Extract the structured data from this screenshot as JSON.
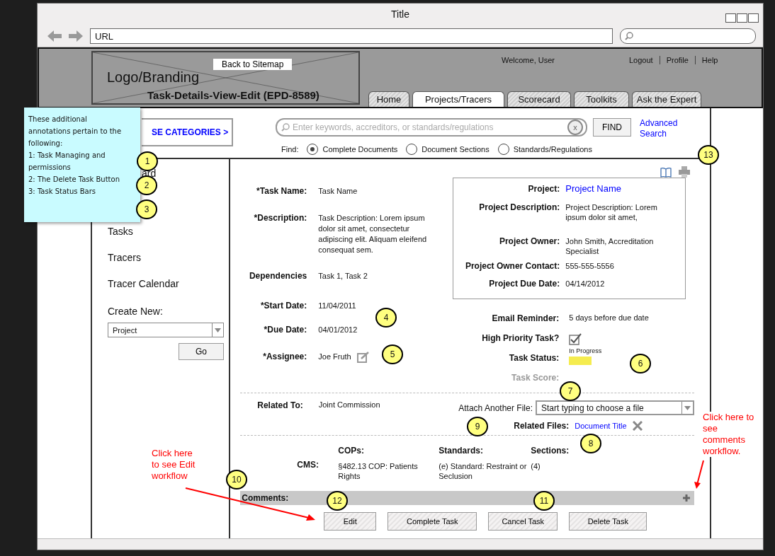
{
  "window": {
    "title": "Title",
    "url": "URL"
  },
  "header": {
    "back_button": "Back to Sitemap",
    "logo": "Logo/Branding",
    "page_title": "Task-Details-View-Edit (EPD-8589)",
    "welcome": "Welcome, User",
    "links": [
      "Logout",
      "Profile",
      "Help"
    ],
    "tabs": [
      {
        "label": "Home",
        "selected": false
      },
      {
        "label": "Projects/Tracers",
        "selected": true
      },
      {
        "label": "Scorecard",
        "selected": false
      },
      {
        "label": "Toolkits",
        "selected": false
      },
      {
        "label": "Ask the Expert",
        "selected": false
      }
    ]
  },
  "search": {
    "categories_button": "SE CATEGORIES >",
    "placeholder": "Enter keywords, accreditors, or standards/regulations",
    "clear": "x",
    "find_button": "FIND",
    "advanced_link": "Advanced Search",
    "find_label": "Find:",
    "options": [
      {
        "label": "Complete Documents",
        "selected": true
      },
      {
        "label": "Document Sections",
        "selected": false
      },
      {
        "label": "Standards/Regulations",
        "selected": false
      }
    ]
  },
  "sidebar": {
    "items": [
      {
        "label": "ard",
        "kind": "cut"
      },
      {
        "label": "Tasks",
        "kind": "full"
      },
      {
        "label": "Tracers",
        "kind": "full"
      },
      {
        "label": "Tracer Calendar",
        "kind": "full"
      }
    ],
    "create_label": "Create New:",
    "create_select": "Project",
    "go_button": "Go"
  },
  "note": {
    "lines": [
      "These additional",
      "annotations pertain to the",
      "following:",
      "1: Task Managing and",
      "permissions",
      "2: The Delete Task Button",
      "3: Task Status Bars"
    ]
  },
  "task": {
    "fields": [
      {
        "label": "*Task Name:",
        "value": "Task Name",
        "kind": "plain"
      },
      {
        "label": "*Description:",
        "value": "Task Description: Lorem ipsum dolor sit amet, consectetur adipiscing elit. Aliquam eleifend consequat sem.",
        "kind": "plain"
      },
      {
        "label": "Dependencies",
        "value": "Task 1, Task 2",
        "kind": "plain"
      },
      {
        "label": "*Start Date:",
        "value": "11/04/2011",
        "kind": "plain"
      },
      {
        "label": "*Due Date:",
        "value": "04/01/2012",
        "kind": "plain"
      },
      {
        "label": "*Assignee:",
        "value": "Joe Fruth",
        "kind": "editable"
      }
    ]
  },
  "project": {
    "fields": [
      {
        "label": "Project:",
        "value": "Project Name",
        "kind": "link"
      },
      {
        "label": "Project Description:",
        "value": "Project Description: Lorem ipsum dolor sit amet,",
        "kind": "text"
      },
      {
        "label": "Project Owner:",
        "value": "John Smith, Accreditation Specialist",
        "kind": "text"
      },
      {
        "label": "Project Owner Contact:",
        "value": "555-555-5556",
        "kind": "text"
      },
      {
        "label": "Project Due Date:",
        "value": "04/14/2012",
        "kind": "text"
      }
    ]
  },
  "meta": {
    "email_label": "Email Reminder:",
    "email_value": "5 days before due date",
    "priority_label": "High Priority Task?",
    "priority_checked": true,
    "status_label": "Task Status:",
    "status_text": "In Progress",
    "score_label": "Task Score:",
    "score_disabled": true
  },
  "related": {
    "label": "Related To:",
    "value": "Joint Commission",
    "attach_label": "Attach Another File:",
    "attach_placeholder": "Start typing to choose a file",
    "files_label": "Related Files:",
    "file_link": "Document Title"
  },
  "cms": {
    "label": "CMS:",
    "columns": [
      {
        "heading": "COPs:",
        "value": "§482.13 COP: Patients Rights"
      },
      {
        "heading": "Standards:",
        "value": "(e) Standard: Restraint or Seclusion"
      },
      {
        "heading": "Sections:",
        "value": "(4)"
      }
    ]
  },
  "comments": {
    "label": "Comments:"
  },
  "buttons": [
    "Edit",
    "Complete Task",
    "Cancel Task",
    "Delete Task"
  ],
  "badges": [
    "1",
    "2",
    "3",
    "4",
    "5",
    "6",
    "7",
    "8",
    "9",
    "10",
    "11",
    "12",
    "13"
  ],
  "annotations": [
    "Click here\nto see Edit\nworkflow",
    "Click here to\nsee\ncomments\nworkflow."
  ]
}
